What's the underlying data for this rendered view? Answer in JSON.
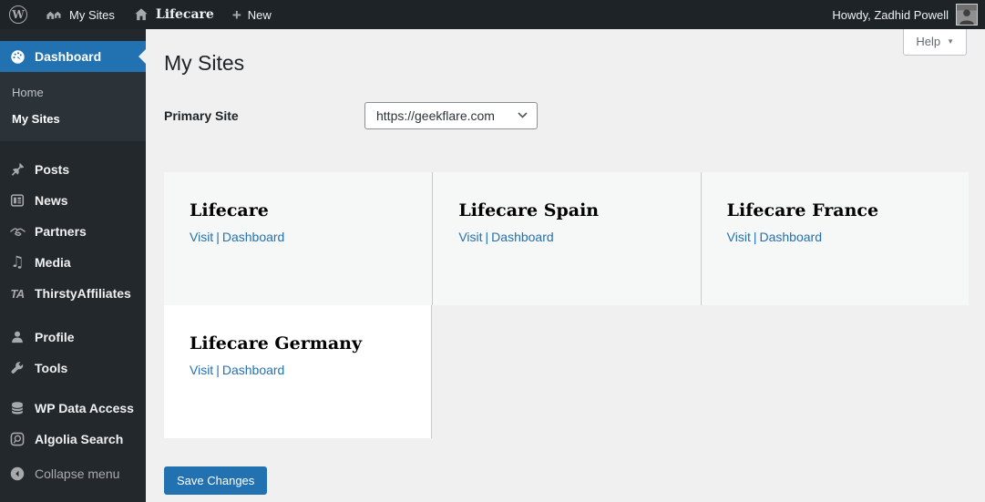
{
  "admin_bar": {
    "my_sites_label": "My Sites",
    "site_name": "Lifecare",
    "new_label": "New",
    "howdy_text": "Howdy, Zadhid Powell"
  },
  "sidebar": {
    "dashboard_label": "Dashboard",
    "submenu": {
      "home_label": "Home",
      "my_sites_label": "My Sites"
    },
    "items": [
      {
        "label": "Posts"
      },
      {
        "label": "News"
      },
      {
        "label": "Partners"
      },
      {
        "label": "Media"
      },
      {
        "label": "ThirstyAffiliates"
      },
      {
        "label": "Profile"
      },
      {
        "label": "Tools"
      },
      {
        "label": "WP Data Access"
      },
      {
        "label": "Algolia Search"
      }
    ],
    "collapse_label": "Collapse menu"
  },
  "main": {
    "page_title": "My Sites",
    "help_label": "Help",
    "primary_site_label": "Primary Site",
    "primary_site_value": "https://geekflare.com",
    "sites": [
      {
        "name": "Lifecare",
        "visit_label": "Visit",
        "dashboard_label": "Dashboard"
      },
      {
        "name": "Lifecare Spain",
        "visit_label": "Visit",
        "dashboard_label": "Dashboard"
      },
      {
        "name": "Lifecare France",
        "visit_label": "Visit",
        "dashboard_label": "Dashboard"
      },
      {
        "name": "Lifecare Germany",
        "visit_label": "Visit",
        "dashboard_label": "Dashboard"
      }
    ],
    "link_separator": "|",
    "save_button_label": "Save Changes"
  },
  "icons": {
    "wordpress_logo_letter": "W",
    "new_plus": "+",
    "thirsty_affiliates_text": "TA",
    "media_glyph": "♫",
    "help_caret": "▼"
  },
  "colors": {
    "admin_bar_bg": "#1d2327",
    "sidebar_bg": "#23282d",
    "submenu_bg": "#2c3338",
    "accent_blue": "#2271b1",
    "link_blue": "#2271b1",
    "content_bg": "#f0f0f1",
    "card_shade_bg": "#f6f7f7",
    "card_white_bg": "#ffffff",
    "divider": "#c9cacc"
  }
}
